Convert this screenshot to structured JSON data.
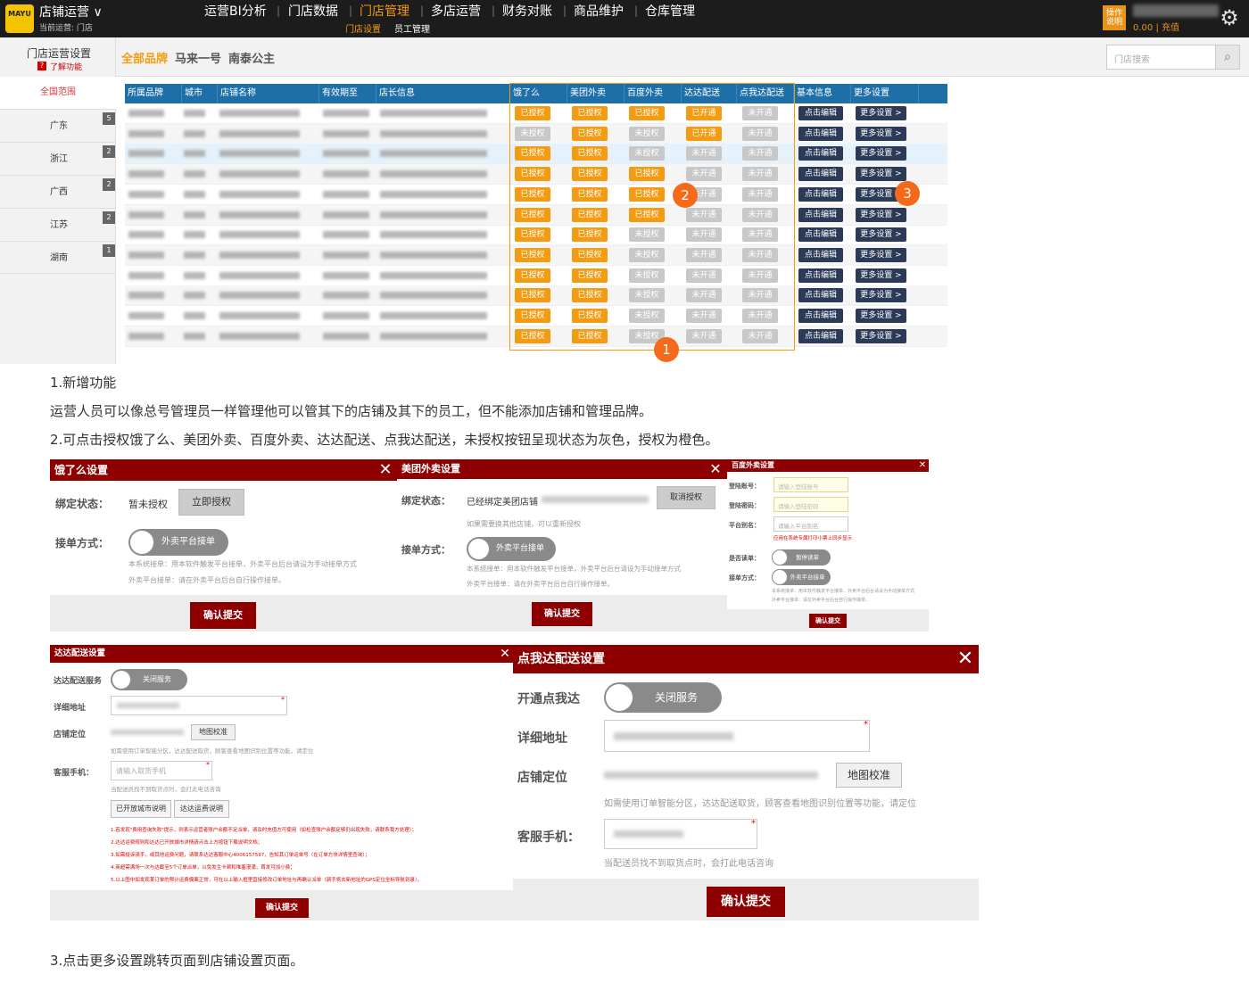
{
  "app": {
    "logo_text": "MAYU",
    "title": "店铺运营",
    "subtitle": "当前运营:",
    "subtitle_store": "门店"
  },
  "nav": {
    "items": [
      "运营BI分析",
      "门店数据",
      "门店管理",
      "多店运营",
      "财务对账",
      "商品维护",
      "仓库管理"
    ],
    "active": "门店管理",
    "sub": [
      "门店设置",
      "员工管理"
    ]
  },
  "header_right": {
    "help": "操作说明",
    "recharge": "0.00 | 充值"
  },
  "store_settings": {
    "title": "门店运营设置",
    "help_icon": "?",
    "learn": "了解功能"
  },
  "brand_tabs": [
    "全部品牌",
    "马来一号",
    "南泰公主"
  ],
  "search": {
    "placeholder": "门店搜索"
  },
  "sidebar": {
    "all": "全国范围",
    "provinces": [
      {
        "name": "广东",
        "count": "5"
      },
      {
        "name": "浙江",
        "count": "2"
      },
      {
        "name": "广西",
        "count": "2"
      },
      {
        "name": "江苏",
        "count": "2"
      },
      {
        "name": "湖南",
        "count": "1"
      }
    ]
  },
  "table": {
    "headers": [
      "所属品牌",
      "城市",
      "店铺名称",
      "有效期至",
      "店长信息",
      "饿了么",
      "美团外卖",
      "百度外卖",
      "达达配送",
      "点我达配送",
      "基本信息",
      "更多设置"
    ],
    "auth_on": "已授权",
    "auth_off": "未授权",
    "open_on": "已开通",
    "open_off": "未开通",
    "edit": "点击编辑",
    "more": "更多设置 >",
    "rows": [
      {
        "e": 1,
        "m": 1,
        "b": 1,
        "d": 1,
        "p": 0
      },
      {
        "e": 0,
        "m": 1,
        "b": 0,
        "d": 1,
        "p": 0
      },
      {
        "e": 1,
        "m": 1,
        "b": 0,
        "d": 0,
        "p": 0
      },
      {
        "e": 1,
        "m": 1,
        "b": 1,
        "d": 0,
        "p": 0
      },
      {
        "e": 1,
        "m": 1,
        "b": 1,
        "d": 0,
        "p": 0
      },
      {
        "e": 1,
        "m": 1,
        "b": 1,
        "d": 0,
        "p": 0
      },
      {
        "e": 1,
        "m": 1,
        "b": 0,
        "d": 0,
        "p": 0
      },
      {
        "e": 1,
        "m": 1,
        "b": 0,
        "d": 0,
        "p": 0
      },
      {
        "e": 1,
        "m": 1,
        "b": 0,
        "d": 0,
        "p": 0
      },
      {
        "e": 1,
        "m": 1,
        "b": 0,
        "d": 0,
        "p": 0
      },
      {
        "e": 1,
        "m": 1,
        "b": 0,
        "d": 0,
        "p": 0
      },
      {
        "e": 1,
        "m": 1,
        "b": 0,
        "d": 0,
        "p": 0
      }
    ]
  },
  "markers": [
    "1",
    "2",
    "3"
  ],
  "notes": {
    "n1": "1.新增功能",
    "n2": "运营人员可以像总号管理员一样管理他可以管其下的店铺及其下的员工，但不能添加店铺和管理品牌。",
    "n3": "2.可点击授权饿了么、美团外卖、百度外卖、达达配送、点我达配送，未授权按钮呈现状态为灰色，授权为橙色。",
    "n4": "3.点击更多设置跳转页面到店铺设置页面。"
  },
  "eleme": {
    "title": "饿了么设置",
    "close": "X",
    "bind_label": "绑定状态：",
    "bind_value": "暂未授权",
    "auth_btn": "立即授权",
    "mode_label": "接单方式：",
    "toggle": "外卖平台接单",
    "tip1": "本系统接单：用本软件触发平台接单，外卖平台后台请设为手动接单方式",
    "tip2": "外卖平台接单：请在外卖平台后台自行操作接单。",
    "submit": "确认提交"
  },
  "meituan": {
    "title": "美团外卖设置",
    "close": "X",
    "bind_label": "绑定状态：",
    "bind_value": "已经绑定美团店铺",
    "cancel_btn": "取消授权",
    "rebind_tip": "如果需要换其他店铺，可以重新授权",
    "mode_label": "接单方式：",
    "toggle": "外卖平台接单",
    "tip1": "本系统接单：用本软件触发平台接单，外卖平台后台请设为手动接单方式",
    "tip2": "外卖平台接单：请在外卖平台后台自行操作接单。",
    "submit": "确认提交"
  },
  "baidu": {
    "title": "百度外卖设置",
    "close": "X",
    "account_label": "登陆账号：",
    "account_ph": "请输入登陆账号",
    "password_label": "登陆密码：",
    "password_ph": "请输入登陆密码",
    "alias_label": "平台别名：",
    "alias_ph": "请输入平台别名",
    "alias_tip": "应用在系统专属打印小票上同步显示",
    "read_label": "是否读单：",
    "read_toggle": "暂停读单",
    "mode_label": "接单方式：",
    "mode_toggle": "外卖平台接单",
    "tip1": "本系统接单：用本软件触发平台接单，外卖平台后台请设为手动接单方式",
    "tip2": "外卖平台接单：请在外卖平台后台自行操作接单。",
    "submit": "确认提交"
  },
  "dada": {
    "title": "达达配送设置",
    "close": "X",
    "service_label": "达达配送服务",
    "service_toggle": "关闭服务",
    "address_label": "详细地址",
    "location_label": "店铺定位",
    "map_btn": "地图校准",
    "location_tip": "如需使用订单智能分区，达达配送取货，顾客查看地图识别位置等功能，请定位",
    "phone_label": "客服手机：",
    "phone_ph": "请输入取货手机",
    "phone_tip": "当配送员找不到取货点时，会打此电话咨询",
    "city_btn": "已开放城市说明",
    "fee_btn": "达达运费说明",
    "notes": [
      "1.若发现\"费用查询失败\"提示，则表示运营者账户余额不足派单，请及时充值方可使用（如检查账户余额足够仍出现失败，请联系我方处理）；",
      "2.达达运费规则和达达已开放城市详情请点击上方按钮下载说明文档；",
      "3.如需投诉骑手，或其他运费问题，请联系达达客服中心4006157597，告知其订单运单号（在订单方块详情里查询）；",
      "4.商超需满场一次与达截至5个订单派单，以免发生卡顿和堆塞漫涌，首发可加小费；",
      "5.以上图中如发现某订单的预计运费偏离正常，可在以上输入框里直接修改订单地址与再确认派单（骑手将去新地址的GPS定位坐标导航到录）。"
    ],
    "submit": "确认提交"
  },
  "dianwoda": {
    "title": "点我达配送设置",
    "close": "X",
    "open_label": "开通点我达",
    "open_toggle": "关闭服务",
    "address_label": "详细地址",
    "location_label": "店铺定位",
    "map_btn": "地图校准",
    "location_tip": "如需使用订单智能分区，达达配送取货，顾客查看地图识别位置等功能，请定位",
    "phone_label": "客服手机：",
    "phone_tip": "当配送员找不到取货点时，会打此电话咨询",
    "submit": "确认提交"
  },
  "colors": {
    "accent": "#f39c12",
    "header": "#1e6fa8",
    "dialog": "#8e0000",
    "dark_btn": "#2b3a57"
  }
}
